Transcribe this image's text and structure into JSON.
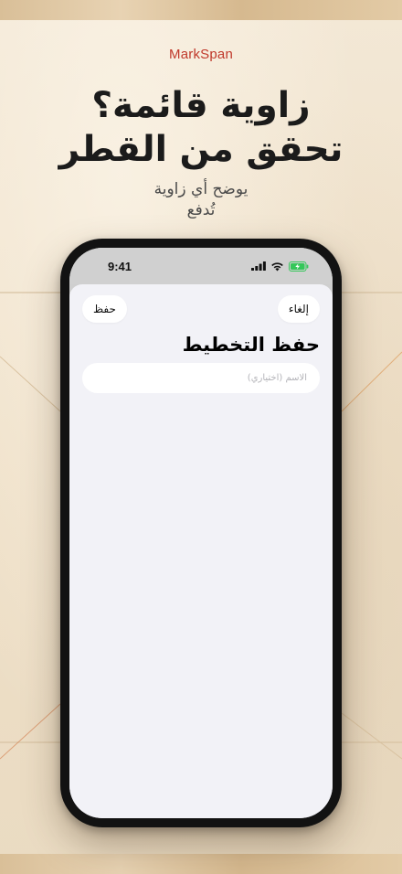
{
  "brand": "MarkSpan",
  "headline": {
    "line1": "زاوية قائمة؟",
    "line2": "تحقق من القطر"
  },
  "subtitle": {
    "line1": "يوضح أي زاوية",
    "line2": "تُدفع"
  },
  "phone": {
    "status_bar": {
      "time": "9:41",
      "icons": [
        "signal-icon",
        "wifi-icon",
        "battery-charging-icon"
      ]
    },
    "sheet": {
      "cancel_label": "إلغاء",
      "save_label": "حفظ",
      "title": "حفظ التخطيط",
      "name_field": {
        "value": "",
        "placeholder": "الاسم (اختياري)"
      }
    }
  },
  "colors": {
    "brand": "#c0392b",
    "sheet_background": "#f2f2f7",
    "battery": "#34c759"
  }
}
